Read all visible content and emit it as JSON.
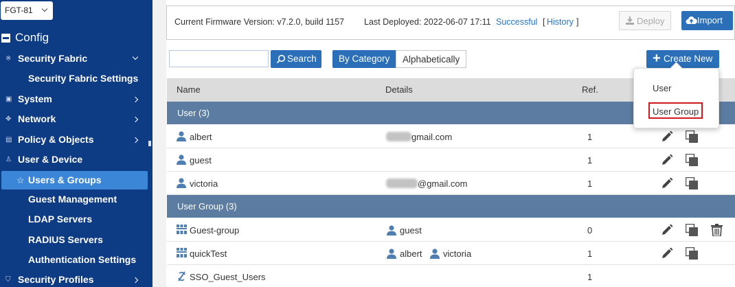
{
  "device": {
    "name": "FGT-81"
  },
  "sidebar": {
    "section": "Config",
    "items": [
      {
        "label": "Security Fabric",
        "icon": "fabric-icon",
        "arrow": "down"
      },
      {
        "label": "Security Fabric Settings",
        "sub": true
      },
      {
        "label": "System",
        "icon": "system-icon",
        "arrow": "right"
      },
      {
        "label": "Network",
        "icon": "network-icon",
        "arrow": "right"
      },
      {
        "label": "Policy & Objects",
        "icon": "policy-icon",
        "arrow": "right"
      },
      {
        "label": "User & Device",
        "icon": "user-device-icon",
        "arrow": "none"
      },
      {
        "label": "Users & Groups",
        "sub": true,
        "active": true
      },
      {
        "label": "Guest Management",
        "sub": true
      },
      {
        "label": "LDAP Servers",
        "sub": true
      },
      {
        "label": "RADIUS Servers",
        "sub": true
      },
      {
        "label": "Authentication Settings",
        "sub": true
      },
      {
        "label": "Security Profiles",
        "icon": "security-profiles-icon",
        "arrow": "right"
      }
    ]
  },
  "firmware": {
    "current": "Current Firmware Version: v7.2.0, build 1157",
    "last_deployed": "Last Deployed: 2022-06-07 17:11",
    "status": "Successful",
    "history_open": "[",
    "history": "History",
    "history_close": "]",
    "deploy_label": "Deploy",
    "import_label": "Import"
  },
  "toolbar": {
    "search_placeholder": "",
    "search_value": "",
    "search_label": "Search",
    "by_category": "By Category",
    "alphabetically": "Alphabetically",
    "create_new": "Create New"
  },
  "table": {
    "headers": {
      "name": "Name",
      "details": "Details",
      "ref": "Ref."
    },
    "groups": [
      {
        "label": "User (3)",
        "rows": [
          {
            "name": "albert",
            "detail": "gmail.com",
            "ref": "1"
          },
          {
            "name": "guest",
            "detail": "",
            "ref": "1"
          },
          {
            "name": "victoria",
            "detail": "@gmail.com",
            "ref": "1"
          }
        ]
      },
      {
        "label": "User Group (3)",
        "rows": [
          {
            "name": "Guest-group",
            "members": [
              "guest"
            ],
            "ref": "0"
          },
          {
            "name": "quickTest",
            "members": [
              "albert",
              "victoria"
            ],
            "ref": "1"
          },
          {
            "name": "SSO_Guest_Users",
            "members": [],
            "ref": "1"
          }
        ]
      }
    ]
  },
  "dropdown": {
    "items": [
      "User",
      "User Group"
    ],
    "highlighted": "User Group"
  },
  "colors": {
    "sidebar_bg": "#0d3b84",
    "active_item": "#3b86d6",
    "button_primary": "#2a6fb8",
    "group_row": "#5c7da1",
    "highlight_border": "#d0191e",
    "link": "#2576c9"
  }
}
